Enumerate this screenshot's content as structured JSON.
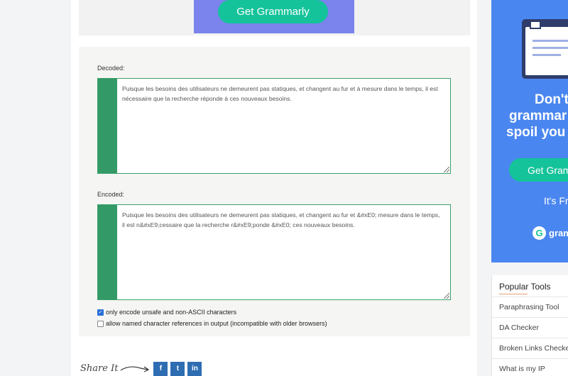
{
  "top_ad": {
    "cta_label": "Get Grammarly"
  },
  "decoded": {
    "label": "Decoded:",
    "text": "Puisque les besoins des utilisateurs ne demeurent pas statiques, et changent au fur et à mesure dans le temps, il est nécessaire que la recherche réponde à ces nouveaux besoins."
  },
  "encoded": {
    "label": "Encoded:",
    "text": "Puisque les besoins des utilisateurs ne demeurent pas statiques, et changent au fur et &#xE0; mesure dans le temps, il est n&#xE9;cessaire que la recherche r&#xE9;ponde &#xE0; ces nouveaux besoins."
  },
  "options": [
    {
      "label": "only encode unsafe and non-ASCII characters",
      "checked": true
    },
    {
      "label": "allow named character references in output (incompatible with older browsers)",
      "checked": false
    }
  ],
  "share": {
    "label": "Share It",
    "buttons": [
      {
        "name": "facebook",
        "glyph": "f",
        "color": "#2f6db3"
      },
      {
        "name": "twitter",
        "glyph": "t",
        "color": "#2f6db3"
      },
      {
        "name": "linkedin",
        "glyph": "in",
        "color": "#2f6db3"
      }
    ]
  },
  "side_ad": {
    "headline_1": "Don't",
    "headline_2": "grammar",
    "headline_3": "spoil you",
    "cta_label": "Get Gram",
    "free_label": "It's Fr",
    "logo_text": "gram",
    "colors": {
      "background": "#4a86f0",
      "accent": "#15c39a"
    }
  },
  "popular_tools": {
    "title": "Popular Tools",
    "items": [
      "Paraphrasing Tool",
      "DA Checker",
      "Broken Links Checker",
      "What is my IP"
    ]
  }
}
